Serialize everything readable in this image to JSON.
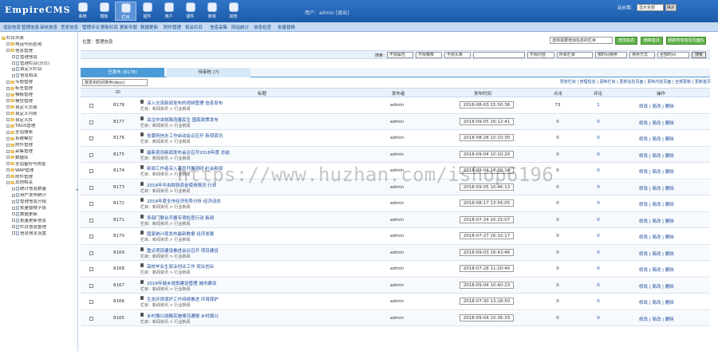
{
  "brand": "EmpireCMS",
  "modules": [
    "系统",
    "模板",
    "栏目",
    "插件",
    "用户",
    "插件",
    "商城",
    "其他"
  ],
  "active_module": 2,
  "user_info": "用户：admin  [退出]",
  "top_right": {
    "label": "站长帮：",
    "select": "显示全部",
    "button": "确定"
  },
  "menu": [
    "增加信息",
    "管理信息",
    "审核信息",
    "签发信息",
    "管理评论",
    "更新栏目",
    "更新专题",
    "数据更新",
    "附件管理",
    "相关栏目",
    "信息采集",
    "网站统计",
    "信息检查",
    "批量替换"
  ],
  "sidebar": [
    {
      "t": "栏目列表",
      "lv": 0,
      "k": "fd"
    },
    {
      "t": "电话号码查询",
      "lv": 1,
      "k": "fd"
    },
    {
      "t": "信息管理",
      "lv": 1,
      "k": "fd"
    },
    {
      "t": "管理信息",
      "lv": 2,
      "k": "fl"
    },
    {
      "t": "管理栏目(分页)",
      "lv": 2,
      "k": "fl"
    },
    {
      "t": "自定义栏目",
      "lv": 2,
      "k": "fl"
    },
    {
      "t": "信息相关",
      "lv": 2,
      "k": "fl"
    },
    {
      "t": "专题管理",
      "lv": 1,
      "k": "fd"
    },
    {
      "t": "标签管理",
      "lv": 1,
      "k": "fd"
    },
    {
      "t": "模板管理",
      "lv": 1,
      "k": "fd"
    },
    {
      "t": "模型管理",
      "lv": 1,
      "k": "fd"
    },
    {
      "t": "自定义页面",
      "lv": 1,
      "k": "fd"
    },
    {
      "t": "自定义列表",
      "lv": 1,
      "k": "fd"
    },
    {
      "t": "自定义JS",
      "lv": 1,
      "k": "fd"
    },
    {
      "t": "TAGS管理",
      "lv": 1,
      "k": "fd"
    },
    {
      "t": "全站搜索",
      "lv": 1,
      "k": "fd"
    },
    {
      "t": "系统模型",
      "lv": 1,
      "k": "fd"
    },
    {
      "t": "附件管理",
      "lv": 1,
      "k": "fd"
    },
    {
      "t": "采集管理",
      "lv": 1,
      "k": "fd"
    },
    {
      "t": "数据库",
      "lv": 1,
      "k": "fd"
    },
    {
      "t": "全站备份与恢复",
      "lv": 1,
      "k": "fd"
    },
    {
      "t": "WAP管理",
      "lv": 1,
      "k": "fd"
    },
    {
      "t": "附件管理",
      "lv": 1,
      "k": "fd"
    },
    {
      "t": "其他相关",
      "lv": 1,
      "k": "fd"
    },
    {
      "t": "统计信息数量",
      "lv": 2,
      "k": "fl"
    },
    {
      "t": "用户发布统计",
      "lv": 2,
      "k": "fl"
    },
    {
      "t": "管理信息分组",
      "lv": 2,
      "k": "fl"
    },
    {
      "t": "批量替换字段",
      "lv": 2,
      "k": "fl"
    },
    {
      "t": "数据更新",
      "lv": 2,
      "k": "fl"
    },
    {
      "t": "批量更新信息",
      "lv": 2,
      "k": "fl"
    },
    {
      "t": "栏目信息整理",
      "lv": 2,
      "k": "fl"
    },
    {
      "t": "信息预览设置",
      "lv": 2,
      "k": "fl"
    }
  ],
  "breadcrumb": "位置：管理信息",
  "action_select": "选择需要增加信息的栏目",
  "green_buttons": [
    "增加信息",
    "刷新首页",
    "刷新所有信息页面JS"
  ],
  "filter": {
    "label": "搜索：",
    "selects": [
      "不限属性",
      "不限推荐",
      "不限头条",
      "不限内容",
      "所有栏目",
      "按时间排序",
      "排序方式",
      "全部时间"
    ],
    "button": "搜索"
  },
  "tabs": {
    "published": "已发布 (8178)",
    "pending": "待审核 (7)"
  },
  "sort_select": "按发布时间排序(desc)",
  "right_links": "预览栏目 | 管理信息 | 更新栏目 | 更新信息页面 | 更新内容页面 | 全部更新 | 更新首页",
  "headers": {
    "id": "ID",
    "title": "标题",
    "author": "发布者",
    "time": "发布时间",
    "clicks": "点击",
    "comments": "评论",
    "ops": "操作"
  },
  "rows": [
    {
      "id": "8178",
      "title": "深入交流新闻发布的视频管理 信息发布",
      "cat": "栏目：新闻资讯 > 行业新闻",
      "author": "admin",
      "time": "2018-08-03 15:50:38",
      "clicks": "73",
      "comments": "1"
    },
    {
      "id": "8177",
      "title": "关注中央财政改善民生 国家政策发布",
      "cat": "栏目：新闻资讯 > 行业新闻",
      "author": "admin",
      "time": "2018-09-05 16:12:41",
      "clicks": "0",
      "comments": "0"
    },
    {
      "id": "8176",
      "title": "省委网信办工作启动会议召开 新闻资讯",
      "cat": "栏目：新闻资讯 > 行业新闻",
      "author": "admin",
      "time": "2018-08-28 10:10:30",
      "clicks": "0",
      "comments": "0"
    },
    {
      "id": "8175",
      "title": "最新资讯新闻发布会议召开2018年度 总结",
      "cat": "栏目：新闻资讯 > 行业新闻",
      "author": "admin",
      "time": "2018-09-04 10:10:20",
      "clicks": "0",
      "comments": "0"
    },
    {
      "id": "8174",
      "title": "新闻工作者深入基层开展调研 社会新闻",
      "cat": "栏目：新闻资讯 > 行业新闻",
      "author": "admin",
      "time": "2018-09-04 18:00:16",
      "clicks": "0",
      "comments": "0"
    },
    {
      "id": "8173",
      "title": "2018年中央财政资金使用情况 行业",
      "cat": "栏目：新闻资讯 > 行业新闻",
      "author": "admin",
      "time": "2018-09-05 10:46:13",
      "clicks": "0",
      "comments": "0"
    },
    {
      "id": "8172",
      "title": "2018年度全市经济形势分析 经济动态",
      "cat": "栏目：新闻资讯 > 行业新闻",
      "author": "admin",
      "time": "2018-08-17 13:56:05",
      "clicks": "0",
      "comments": "0"
    },
    {
      "id": "8171",
      "title": "多部门联合开展专项检查行动 新闻",
      "cat": "栏目：新闻资讯 > 行业新闻",
      "author": "admin",
      "time": "2018-07-24 16:15:07",
      "clicks": "0",
      "comments": "0"
    },
    {
      "id": "8170",
      "title": "国家统计局发布最新数据 经济发展",
      "cat": "栏目：新闻资讯 > 行业新闻",
      "author": "admin",
      "time": "2018-07-27 16:32:17",
      "clicks": "0",
      "comments": "0"
    },
    {
      "id": "8169",
      "title": "重点项目建设推进会议召开 项目建设",
      "cat": "栏目：新闻资讯 > 行业新闻",
      "author": "admin",
      "time": "2018-09-03 16:43:46",
      "clicks": "0",
      "comments": "0"
    },
    {
      "id": "8168",
      "title": "高校毕业生就业创业工作 就业创业",
      "cat": "栏目：新闻资讯 > 行业新闻",
      "author": "admin",
      "time": "2018-07-28 11:20:40",
      "clicks": "0",
      "comments": "0"
    },
    {
      "id": "8167",
      "title": "2018年城乡规划建设管理 城市建设",
      "cat": "栏目：新闻资讯 > 行业新闻",
      "author": "admin",
      "time": "2018-09-04 10:40:23",
      "clicks": "0",
      "comments": "0"
    },
    {
      "id": "8166",
      "title": "生态环境保护工作持续推进 环境保护",
      "cat": "栏目：新闻资讯 > 行业新闻",
      "author": "admin",
      "time": "2018-07-30 13:28:50",
      "clicks": "0",
      "comments": "0"
    },
    {
      "id": "8165",
      "title": "乡村振兴战略实施情况通报 乡村振兴",
      "cat": "栏目：新闻资讯 > 行业新闻",
      "author": "admin",
      "time": "2018-09-04 10:36:33",
      "clicks": "0",
      "comments": "0"
    }
  ],
  "ops": {
    "edit": "修改",
    "copy": "简改",
    "del": "删除"
  },
  "watermark": "https://www.huzhan.com/ishop6196"
}
